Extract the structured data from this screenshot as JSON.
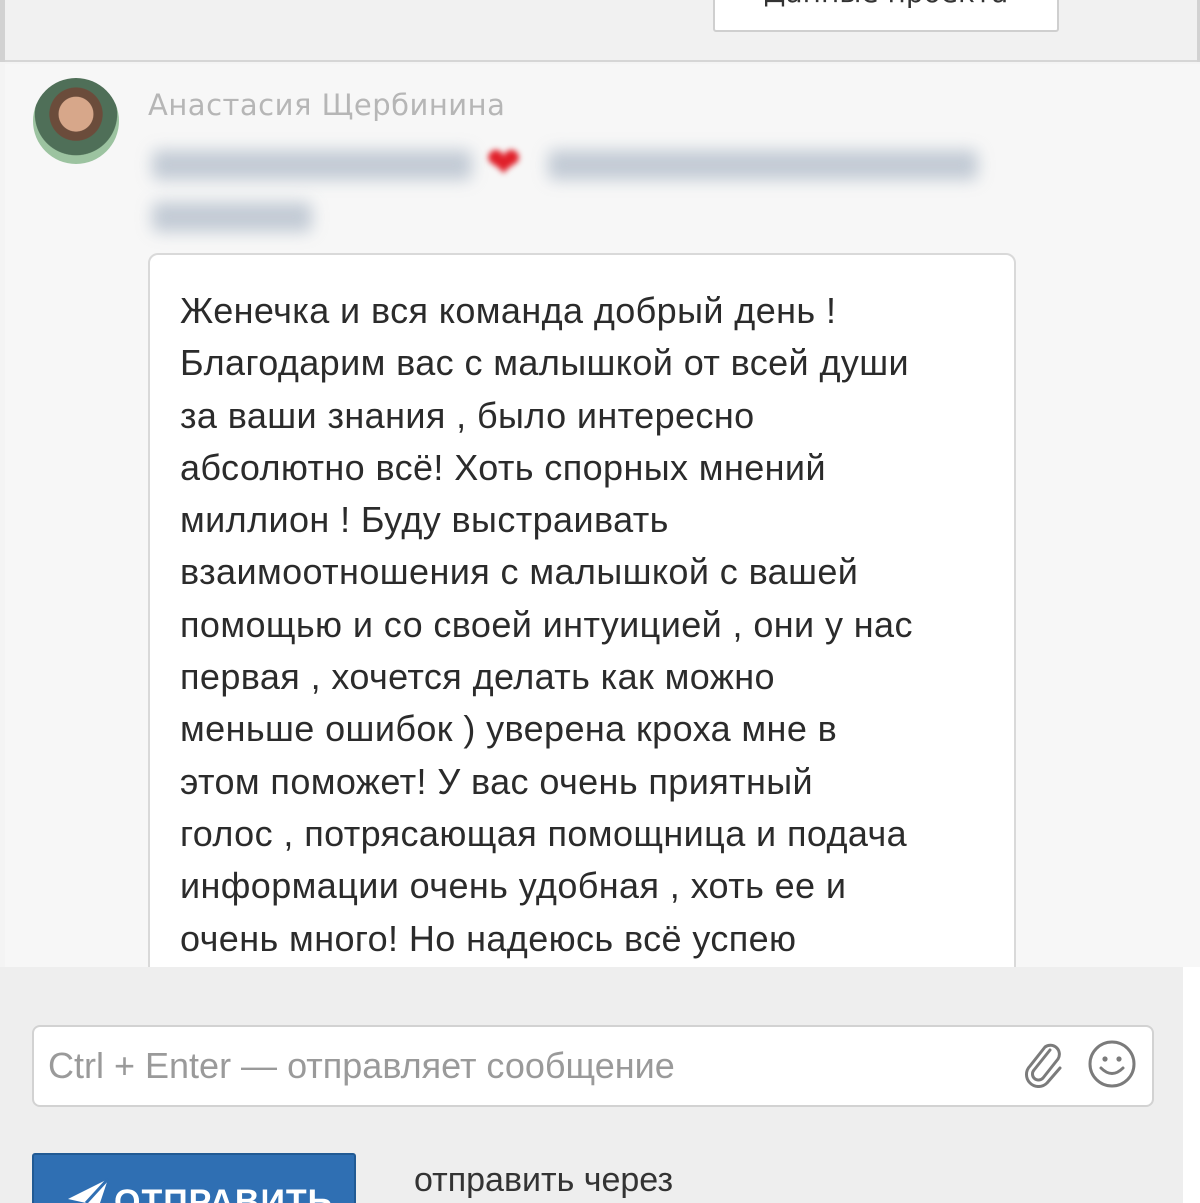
{
  "header": {
    "button_label": "Данные проекта"
  },
  "message": {
    "author": "Анастасия Щербинина",
    "preview_icon": "heart-icon",
    "text": "Женечка и вся команда добрый день !\nБлагодарим вас с малышкой от всей души\nза ваши знания , было интересно\nабсолютно всё! Хоть спорных мнений\nмиллион ! Буду выстраивать\nвзаимоотношения с малышкой с вашей\nпомощью и со своей интуицией , они у нас\nпервая , хочется делать как можно\nменьше ошибок ) уверена кроха мне в\nэтом поможет! У вас очень приятный\nголос , потрясающая помощница и подача\nинформации очень удобная , хоть ее и\nочень много! Но надеюсь всё успею"
  },
  "composer": {
    "placeholder": "Ctrl + Enter — отправляет сообщение",
    "value": "",
    "attach_icon": "paperclip-icon",
    "emoji_icon": "smiley-icon",
    "send_label": "ОТПРАВИТЬ",
    "send_icon": "paper-plane-icon",
    "send_via_label": "отправить через"
  },
  "colors": {
    "send_button": "#2f6fb3",
    "heart": "#e0202a",
    "author_name": "#b6b6b6"
  }
}
